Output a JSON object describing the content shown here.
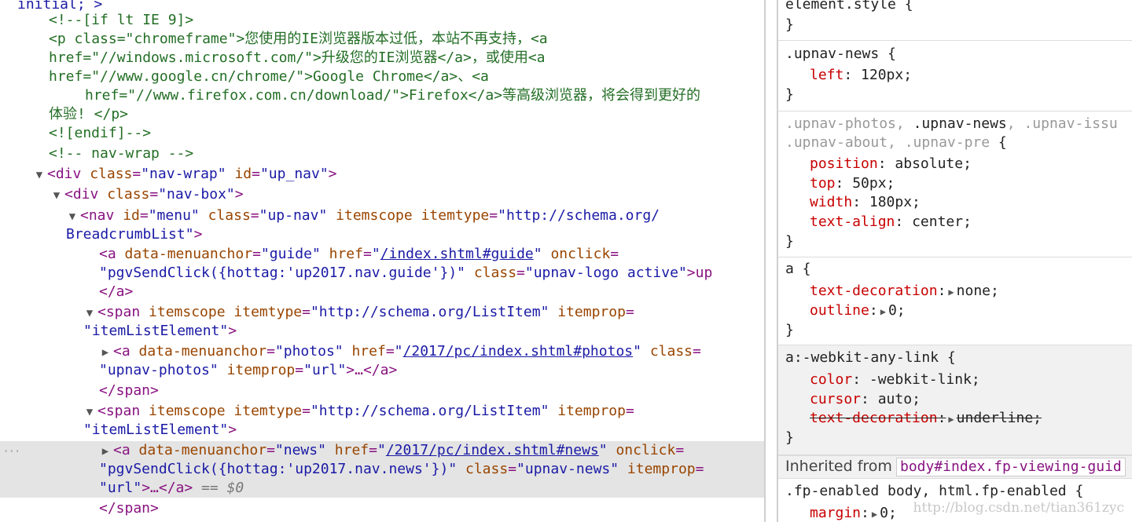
{
  "dom": {
    "l0": "initial; >",
    "l1": "<!--[if lt IE 9]>",
    "l2a": "<p ",
    "l2b": "class",
    "l2c": "=\"",
    "l2d": "chromeframe",
    "l2e": "\">您使用的IE浏览器版本过低，本站不再支持，<a",
    "l3a": "href",
    "l3b": "=\"//windows.microsoft.com/\">",
    "l3c": "升级您的IE浏览器</a>，或使用<a",
    "l4a": "href",
    "l4b": "=\"//www.google.cn/chrome/\">",
    "l4c": "Google Chrome</a>、<a",
    "l5a": "href",
    "l5b": "=\"//www.firefox.com.cn/download/\">",
    "l5c": "Firefox</a>等高级浏览器，将会得到更好的",
    "l6": "体验! </p>",
    "l7": "<![endif]-->",
    "l8": "<!-- nav-wrap -->",
    "l9": {
      "tag": "<div ",
      "a1": "class",
      "v1": "\"nav-wrap\"",
      "a2": "id",
      "v2": "\"up_nav\"",
      "end": ">"
    },
    "l10": {
      "tag": "<div ",
      "a1": "class",
      "v1": "\"nav-box\"",
      "end": ">"
    },
    "l11": {
      "tag": "<nav ",
      "a1": "id",
      "v1": "\"menu\"",
      "a2": "class",
      "v2": "\"up-nav\"",
      "a3": "itemscope",
      "a4": "itemtype",
      "v4": "\"http://schema.org/"
    },
    "l12": {
      "v": "BreadcrumbList\"",
      "end": ">"
    },
    "l13": {
      "tag": "<a ",
      "a1": "data-menuanchor",
      "v1": "\"guide\"",
      "a2": "href",
      "q1": "\"",
      "link": "/index.shtml#guide",
      "q2": "\"",
      "a3": "onclick",
      "eq": "="
    },
    "l14": {
      "v1": "\"pgvSendClick({hottag:'up2017.nav.guide'})\"",
      "a2": "class",
      "v2": "\"upnav-logo active\"",
      "end": ">up"
    },
    "l15": "</a>",
    "l16": {
      "tag": "<span ",
      "a1": "itemscope",
      "a2": "itemtype",
      "v2": "\"http://schema.org/ListItem\"",
      "a3": "itemprop",
      "eq": "="
    },
    "l17": {
      "v": "\"itemListElement\"",
      "end": ">"
    },
    "l18": {
      "tag": "<a ",
      "a1": "data-menuanchor",
      "v1": "\"photos\"",
      "a2": "href",
      "q1": "\"",
      "link": "/2017/pc/index.shtml#photos",
      "q2": "\"",
      "a3": "class",
      "eq": "="
    },
    "l19": {
      "v1": "\"upnav-photos\"",
      "a2": "itemprop",
      "v2": "\"url\"",
      "end": ">…</a>"
    },
    "l20": "</span>",
    "l21": {
      "tag": "<span ",
      "a1": "itemscope",
      "a2": "itemtype",
      "v2": "\"http://schema.org/ListItem\"",
      "a3": "itemprop",
      "eq": "="
    },
    "l22": {
      "v": "\"itemListElement\"",
      "end": ">"
    },
    "l23": {
      "tag": "<a ",
      "a1": "data-menuanchor",
      "v1": "\"news\"",
      "a2": "href",
      "q1": "\"",
      "link": "/2017/pc/index.shtml#news",
      "q2": "\"",
      "a3": "onclick",
      "eq": "="
    },
    "l24": {
      "v1": "\"pgvSendClick({hottag:'up2017.nav.news'})\"",
      "a2": "class",
      "v2": "\"upnav-news\"",
      "a3": "itemprop",
      "eq": "="
    },
    "l25": {
      "v1": "\"url\"",
      "end": ">…</a>",
      "dollar": " == $0"
    },
    "l26": "</span>",
    "dots": "···"
  },
  "styles": {
    "r0": {
      "sel": "element.style {",
      "close": "}"
    },
    "r1": {
      "sel": ".upnav-news {",
      "p1n": "left",
      "p1v": "120px;",
      "close": "}"
    },
    "r2": {
      "s1": ".upnav-photos, ",
      "s2": ".upnav-news",
      "s3": ", .upnav-issu",
      "s4": ".upnav-about, .upnav-pre",
      "s5": " {",
      "p1n": "position",
      "p1v": "absolute;",
      "p2n": "top",
      "p2v": "50px;",
      "p3n": "width",
      "p3v": "180px;",
      "p4n": "text-align",
      "p4v": "center;",
      "close": "}"
    },
    "r3": {
      "sel": "a {",
      "p1n": "text-decoration",
      "p1v": "none;",
      "p2n": "outline",
      "p2v": "0;",
      "close": "}"
    },
    "r4": {
      "sel": "a:-webkit-any-link {",
      "p1n": "color",
      "p1v": "-webkit-link;",
      "p2n": "cursor",
      "p2v": "auto;",
      "p3n": "text-decoration",
      "p3v": "underline;",
      "close": "}"
    },
    "inherited_label": "Inherited from",
    "inherited_link": "body#index.fp-viewing-guid",
    "r5": {
      "sel": ".fp-enabled body, html.fp-enabled {",
      "p1n": "margin",
      "p1v": "0;"
    },
    "colon": ": ",
    "colon_bare": ":"
  },
  "watermark": "http://blog.csdn.net/tian361zyc"
}
